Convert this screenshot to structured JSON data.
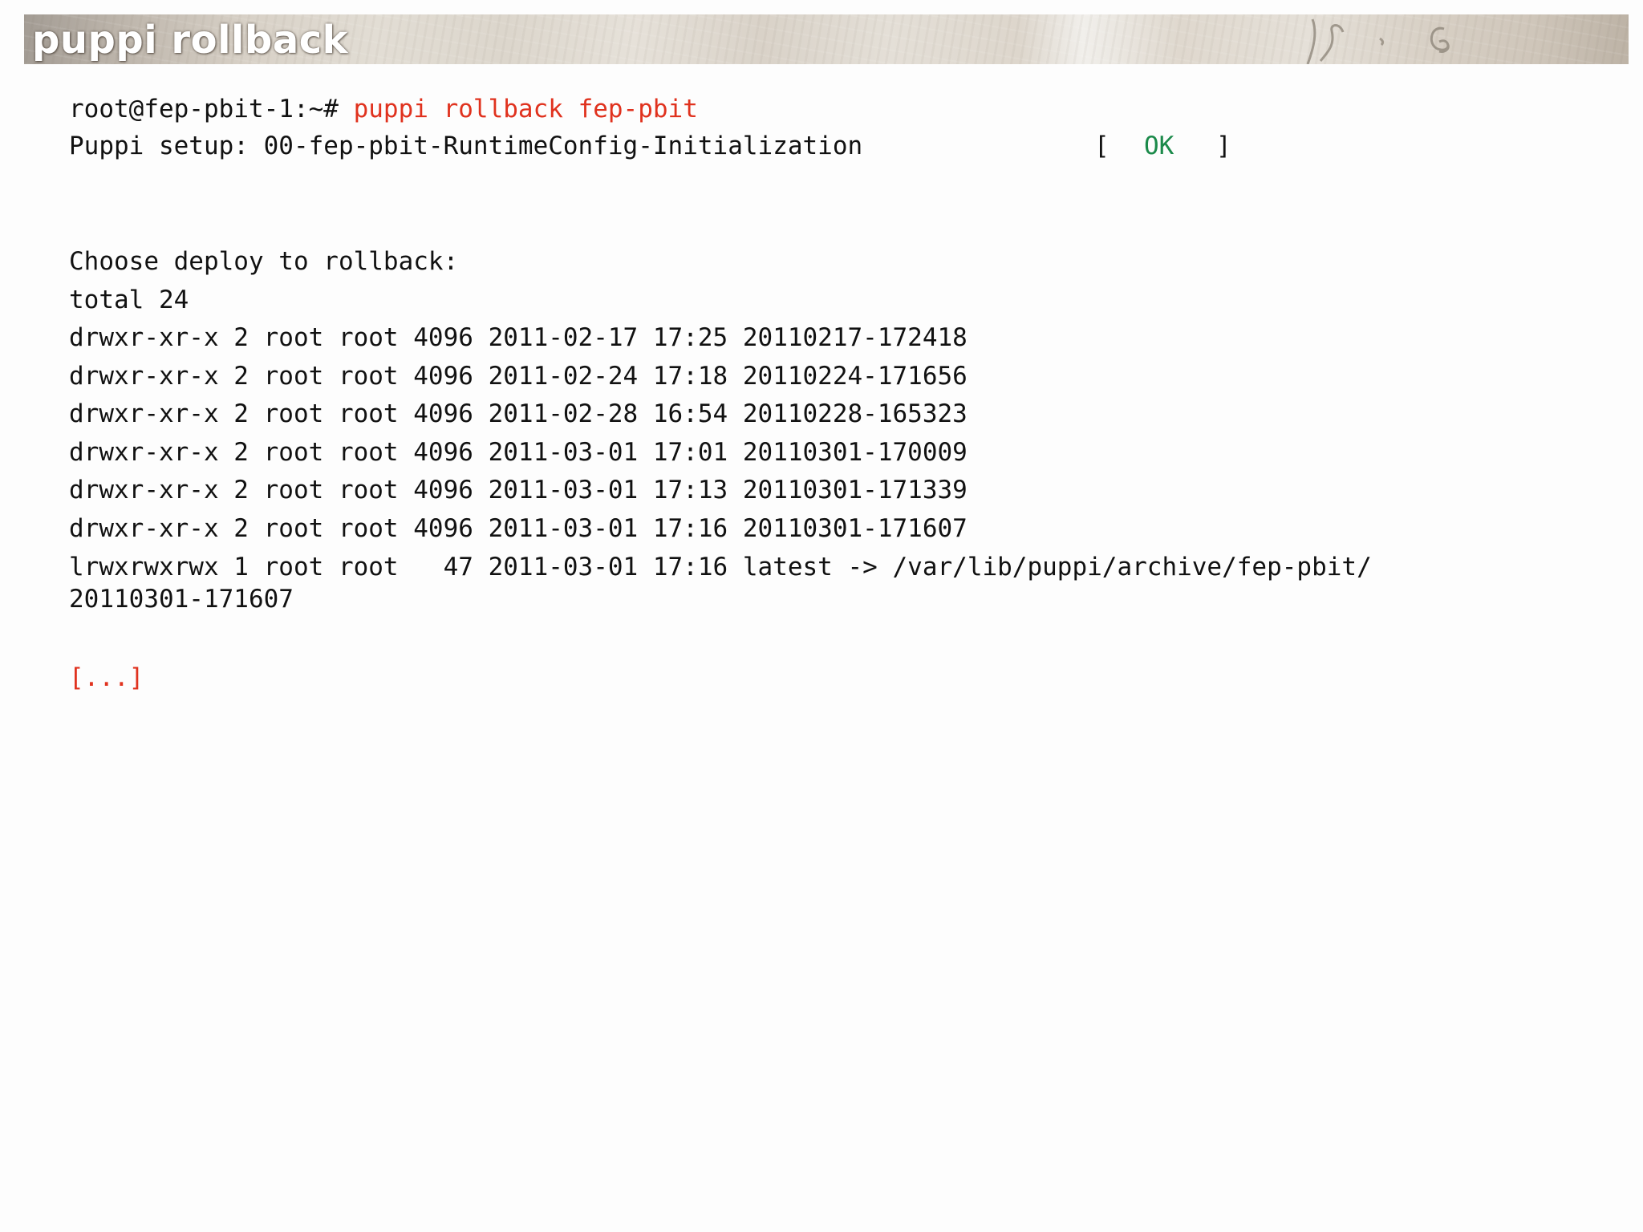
{
  "header": {
    "title": "puppi rollback"
  },
  "terminal": {
    "prompt": "root@fep-pbit-1:~# ",
    "command": "puppi rollback fep-pbit",
    "setup_label": "Puppi setup: 00-fep-pbit-RuntimeConfig-Initialization",
    "status_open": "[",
    "status": "OK",
    "status_close": "]",
    "choose_text": "Choose deploy to rollback:",
    "total_text": "total 24",
    "listing": [
      "drwxr-xr-x 2 root root 4096 2011-02-17 17:25 20110217-172418",
      "drwxr-xr-x 2 root root 4096 2011-02-24 17:18 20110224-171656",
      "drwxr-xr-x 2 root root 4096 2011-02-28 16:54 20110228-165323",
      "drwxr-xr-x 2 root root 4096 2011-03-01 17:01 20110301-170009",
      "drwxr-xr-x 2 root root 4096 2011-03-01 17:13 20110301-171339",
      "drwxr-xr-x 2 root root 4096 2011-03-01 17:16 20110301-171607",
      "lrwxrwxrwx 1 root root   47 2011-03-01 17:16 latest -> /var/lib/puppi/archive/fep-pbit/"
    ],
    "wrapped_line": "20110301-171607",
    "ellipsis": "[...]"
  },
  "colors": {
    "command": "#e0321e",
    "ok": "#1b8a4a",
    "text": "#111111"
  }
}
